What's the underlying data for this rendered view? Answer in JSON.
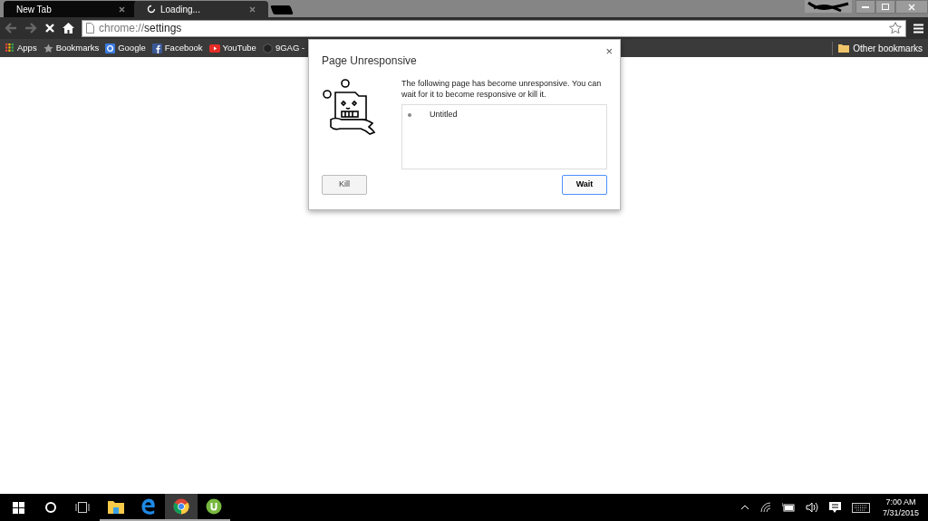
{
  "tabs": [
    {
      "title": "New Tab",
      "selected": false,
      "loading": false
    },
    {
      "title": "Loading...",
      "selected": true,
      "loading": true
    }
  ],
  "address_bar": {
    "scheme": "chrome://",
    "path": "settings"
  },
  "bookmarks": [
    {
      "label": "Apps",
      "kind": "apps"
    },
    {
      "label": "Bookmarks",
      "kind": "star"
    },
    {
      "label": "Google",
      "kind": "google"
    },
    {
      "label": "Facebook",
      "kind": "facebook"
    },
    {
      "label": "YouTube",
      "kind": "youtube"
    },
    {
      "label": "9GAG -",
      "kind": "ninegag"
    }
  ],
  "other_bookmarks": "Other bookmarks",
  "dialog": {
    "title": "Page Unresponsive",
    "close": "×",
    "message": "The following page has become unresponsive. You can wait for it to become responsive or kill it.",
    "pages": [
      "Untitled"
    ],
    "buttons": [
      {
        "label": "Kill",
        "default": false
      },
      {
        "label": "Wait",
        "default": true
      }
    ]
  },
  "taskbar": {
    "apps": [
      {
        "kind": "explorer",
        "running": true,
        "selected": false
      },
      {
        "kind": "edge",
        "running": true,
        "selected": false
      },
      {
        "kind": "chrome",
        "running": true,
        "selected": true
      },
      {
        "kind": "utorrent",
        "running": true,
        "selected": false
      }
    ],
    "time": "7:00 AM",
    "date": "7/31/2015"
  }
}
